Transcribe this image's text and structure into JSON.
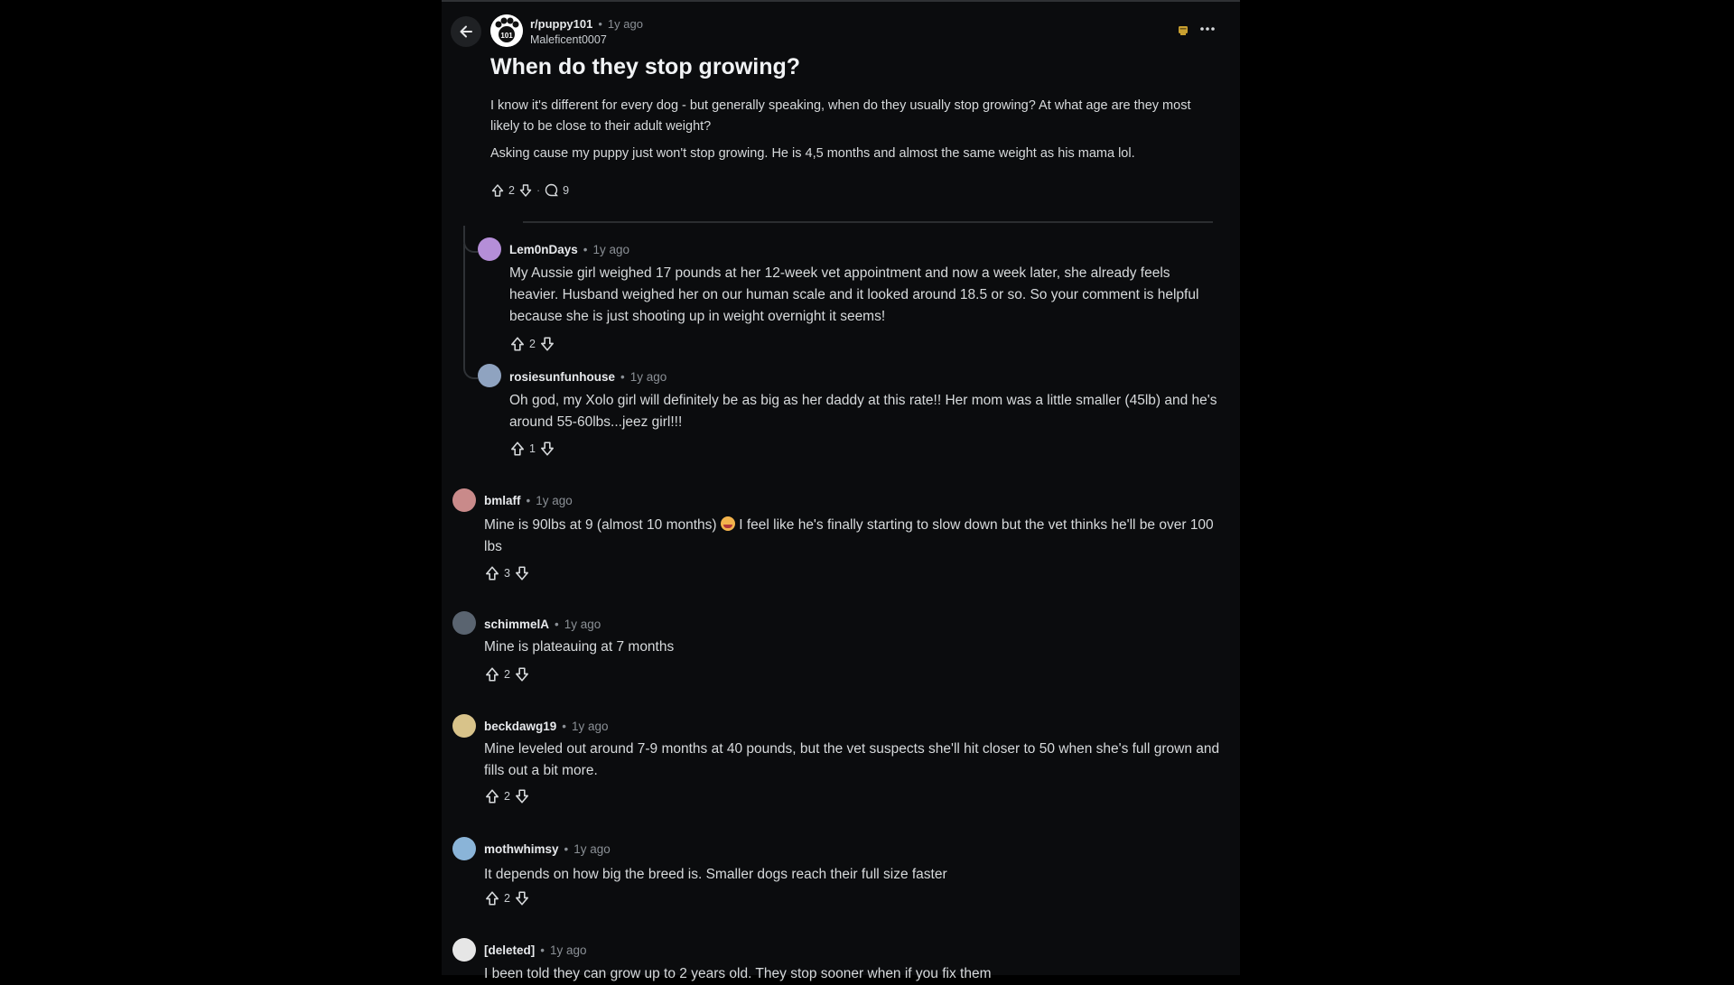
{
  "post": {
    "subreddit": "r/puppy101",
    "time": "1y ago",
    "author": "Maleficent0007",
    "title": "When do they stop growing?",
    "body": [
      "I know it's different for every dog - but generally speaking, when do they usually stop growing? At what age are they most likely to be close to their adult weight?",
      "Asking cause my puppy just won't stop growing. He is 4,5 months and almost the same weight as his mama lol."
    ],
    "upvotes": "2",
    "comments": "9",
    "sub_badge": "101"
  },
  "separator": "•",
  "dot_sep": "·",
  "comments": [
    {
      "user": "Lem0nDays",
      "time": "1y ago",
      "text": "My Aussie girl weighed 17 pounds at her 12-week vet appointment and now a week later, she already feels heavier. Husband weighed her on our human scale and it looked around 18.5 or so. So your comment is helpful because she is just shooting up in weight overnight it seems!",
      "votes": "2",
      "avatar_color": "#b58ed8"
    },
    {
      "user": "rosiesunfunhouse",
      "time": "1y ago",
      "text": "Oh god, my Xolo girl will definitely be as big as her daddy at this rate!! Her mom was a little smaller (45lb) and he's around 55-60lbs...jeez girl!!!",
      "votes": "1",
      "avatar_color": "#8fa3c0"
    },
    {
      "user": "bmlaff",
      "time": "1y ago",
      "text_before": "Mine is 90lbs at 9 (almost 10 months)",
      "text_after": "I feel like he's finally starting to slow down but the vet thinks he'll be over 100 lbs",
      "votes": "3",
      "avatar_color": "#c98a8a"
    },
    {
      "user": "schimmelA",
      "time": "1y ago",
      "text": "Mine is plateauing at 7 months",
      "votes": "2",
      "avatar_color": "#5a6470"
    },
    {
      "user": "beckdawg19",
      "time": "1y ago",
      "text": "Mine leveled out around 7-9 months at 40 pounds, but the vet suspects she'll hit closer to 50 when she's full grown and fills out a bit more.",
      "votes": "2",
      "avatar_color": "#d8c38a"
    },
    {
      "user": "mothwhimsy",
      "time": "1y ago",
      "text": "It depends on how big the breed is. Smaller dogs reach their full size faster",
      "votes": "2",
      "avatar_color": "#8ab4d8"
    },
    {
      "user": "[deleted]",
      "time": "1y ago",
      "text": "I been told they can grow up to 2 years old. They stop sooner when if you fix them",
      "votes": "",
      "avatar_color": "#e6e6e6"
    }
  ]
}
